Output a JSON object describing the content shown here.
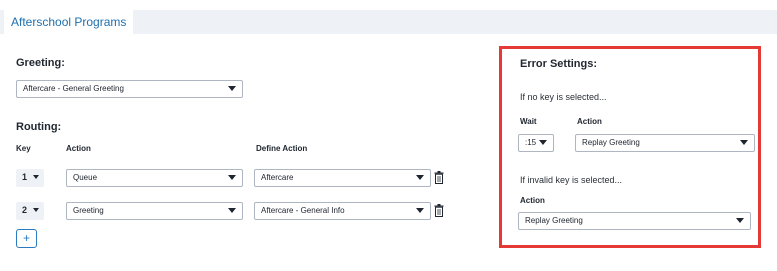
{
  "header": {
    "title": "Afterschool Programs"
  },
  "greeting": {
    "heading": "Greeting:",
    "selected": "Aftercare - General Greeting"
  },
  "routing": {
    "heading": "Routing:",
    "columns": {
      "key": "Key",
      "action": "Action",
      "define_action": "Define Action"
    },
    "rows": [
      {
        "key": "1",
        "action": "Queue",
        "define": "Aftercare"
      },
      {
        "key": "2",
        "action": "Greeting",
        "define": "Aftercare - General Info"
      }
    ],
    "add_label": "+"
  },
  "error_settings": {
    "heading": "Error Settings:",
    "no_key_text": "If no key is selected...",
    "wait_label": "Wait",
    "action_label": "Action",
    "wait_value": ":15",
    "no_key_action": "Replay Greeting",
    "invalid_key_text": "If invalid key is selected...",
    "invalid_action_label": "Action",
    "invalid_key_action": "Replay Greeting"
  },
  "colors": {
    "accent": "#2a7bbf",
    "header_bg": "#eef2f7",
    "highlight_border": "#e53935"
  },
  "icons": {
    "dropdown": "chevron-down-icon",
    "delete": "trash-icon",
    "add": "plus-icon"
  }
}
